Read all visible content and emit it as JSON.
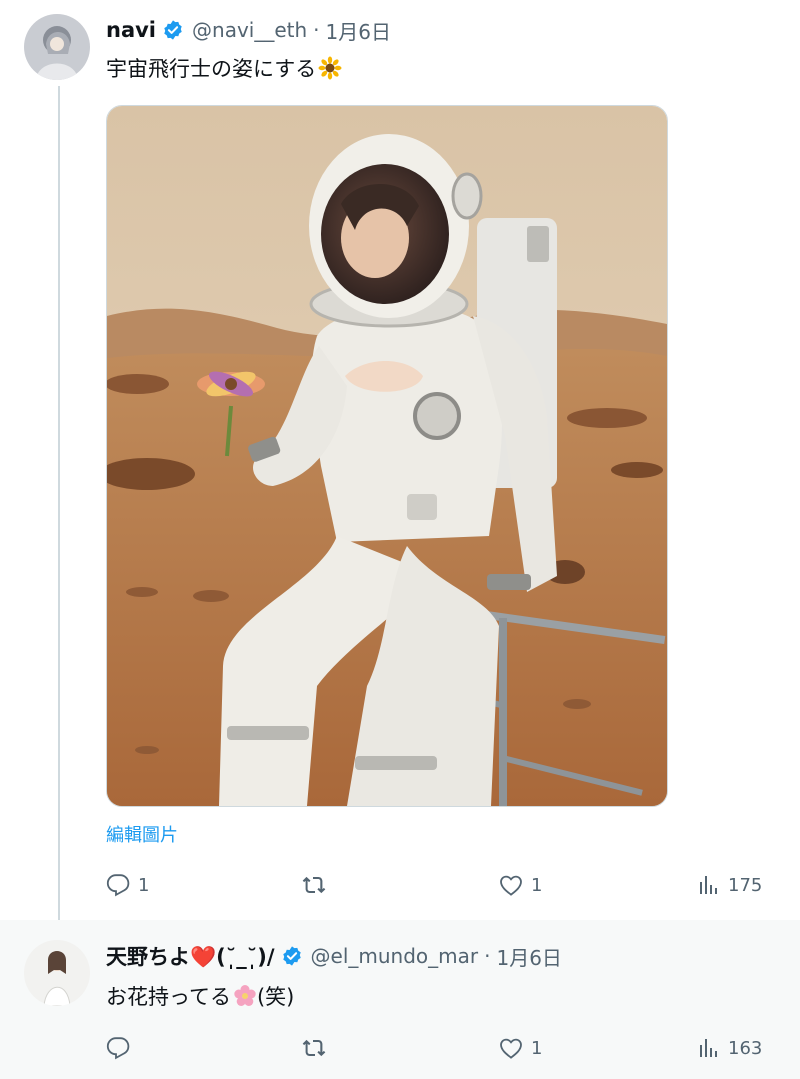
{
  "thread": {
    "tweets": [
      {
        "author_name": "navi",
        "handle": "@navi__eth",
        "separator": "·",
        "date": "1月6日",
        "text": "宇宙飛行士の姿にする",
        "text_emoji": "sunflower-emoji",
        "media_edit_label": "編輯圖片",
        "reply_count": "1",
        "retweet_count": "",
        "like_count": "1",
        "view_count": "175"
      },
      {
        "author_name": "天野ちよ❤️(˘̩̩̩̩_˘̩̩̩̩)/",
        "handle": "@el_mundo_mar",
        "separator": "·",
        "date": "1月6日",
        "text": "お花持ってる",
        "text_emoji": "cherry-blossom-emoji",
        "text_suffix": "(笑)",
        "reply_count": "",
        "retweet_count": "",
        "like_count": "1",
        "view_count": "163"
      }
    ]
  },
  "colors": {
    "accent": "#1d9bf0",
    "secondary_text": "#536471",
    "primary_text": "#0f1419"
  },
  "icons": [
    "reply-icon",
    "retweet-icon",
    "like-icon",
    "views-icon",
    "verified-badge-icon"
  ]
}
